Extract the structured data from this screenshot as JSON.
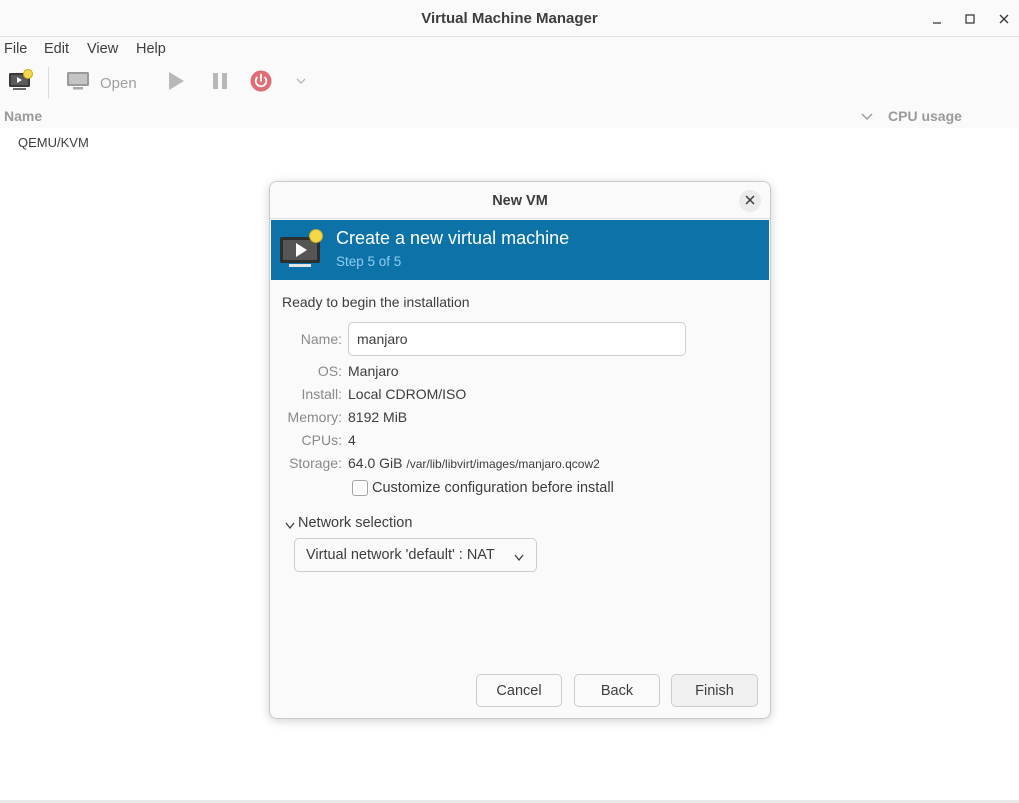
{
  "window": {
    "title": "Virtual Machine Manager",
    "controls": {
      "minimize_icon": "minimize-icon",
      "maximize_icon": "maximize-icon",
      "close_icon": "close-icon"
    }
  },
  "menubar": {
    "items": [
      "File",
      "Edit",
      "View",
      "Help"
    ]
  },
  "toolbar": {
    "open_label": "Open"
  },
  "list": {
    "columns": {
      "name": "Name",
      "cpu": "CPU usage"
    },
    "connections": [
      "QEMU/KVM"
    ]
  },
  "dialog": {
    "title": "New VM",
    "banner": {
      "title": "Create a new virtual machine",
      "subtitle": "Step 5 of 5"
    },
    "ready_text": "Ready to begin the installation",
    "fields": {
      "name": {
        "label": "Name:",
        "value": "manjaro"
      },
      "os": {
        "label": "OS:",
        "value": "Manjaro"
      },
      "install": {
        "label": "Install:",
        "value": "Local CDROM/ISO"
      },
      "memory": {
        "label": "Memory:",
        "value": "8192 MiB"
      },
      "cpus": {
        "label": "CPUs:",
        "value": "4"
      },
      "storage": {
        "label": "Storage:",
        "value": "64.0 GiB",
        "path": "/var/lib/libvirt/images/manjaro.qcow2"
      }
    },
    "customize_label": "Customize configuration before install",
    "customize_checked": false,
    "network": {
      "expander_label": "Network selection",
      "selected": "Virtual network 'default' : NAT"
    },
    "buttons": {
      "cancel": "Cancel",
      "back": "Back",
      "finish": "Finish"
    }
  },
  "colors": {
    "banner": "#0c72a8",
    "banner_subtitle": "#8ecdf2",
    "power_button": "#e06c75"
  }
}
